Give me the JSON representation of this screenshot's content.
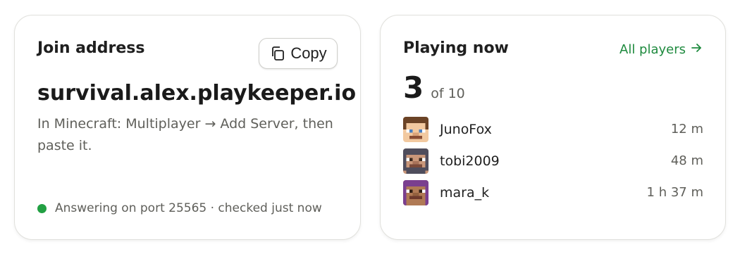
{
  "join": {
    "title": "Join address",
    "copy_label": "Copy",
    "address": "survival.alex.playkeeper.io",
    "hint": "In Minecraft: Multiplayer → Add Server, then paste it.",
    "status": "Answering on port 25565 · checked just now",
    "status_color": "#22a043"
  },
  "players": {
    "title": "Playing now",
    "all_link": "All players",
    "count": "3",
    "count_of": "of 10",
    "link_color": "#1e8a3e",
    "list": [
      {
        "name": "JunoFox",
        "time": "12 m"
      },
      {
        "name": "tobi2009",
        "time": "48 m"
      },
      {
        "name": "mara_k",
        "time": "1 h 37 m"
      }
    ]
  }
}
